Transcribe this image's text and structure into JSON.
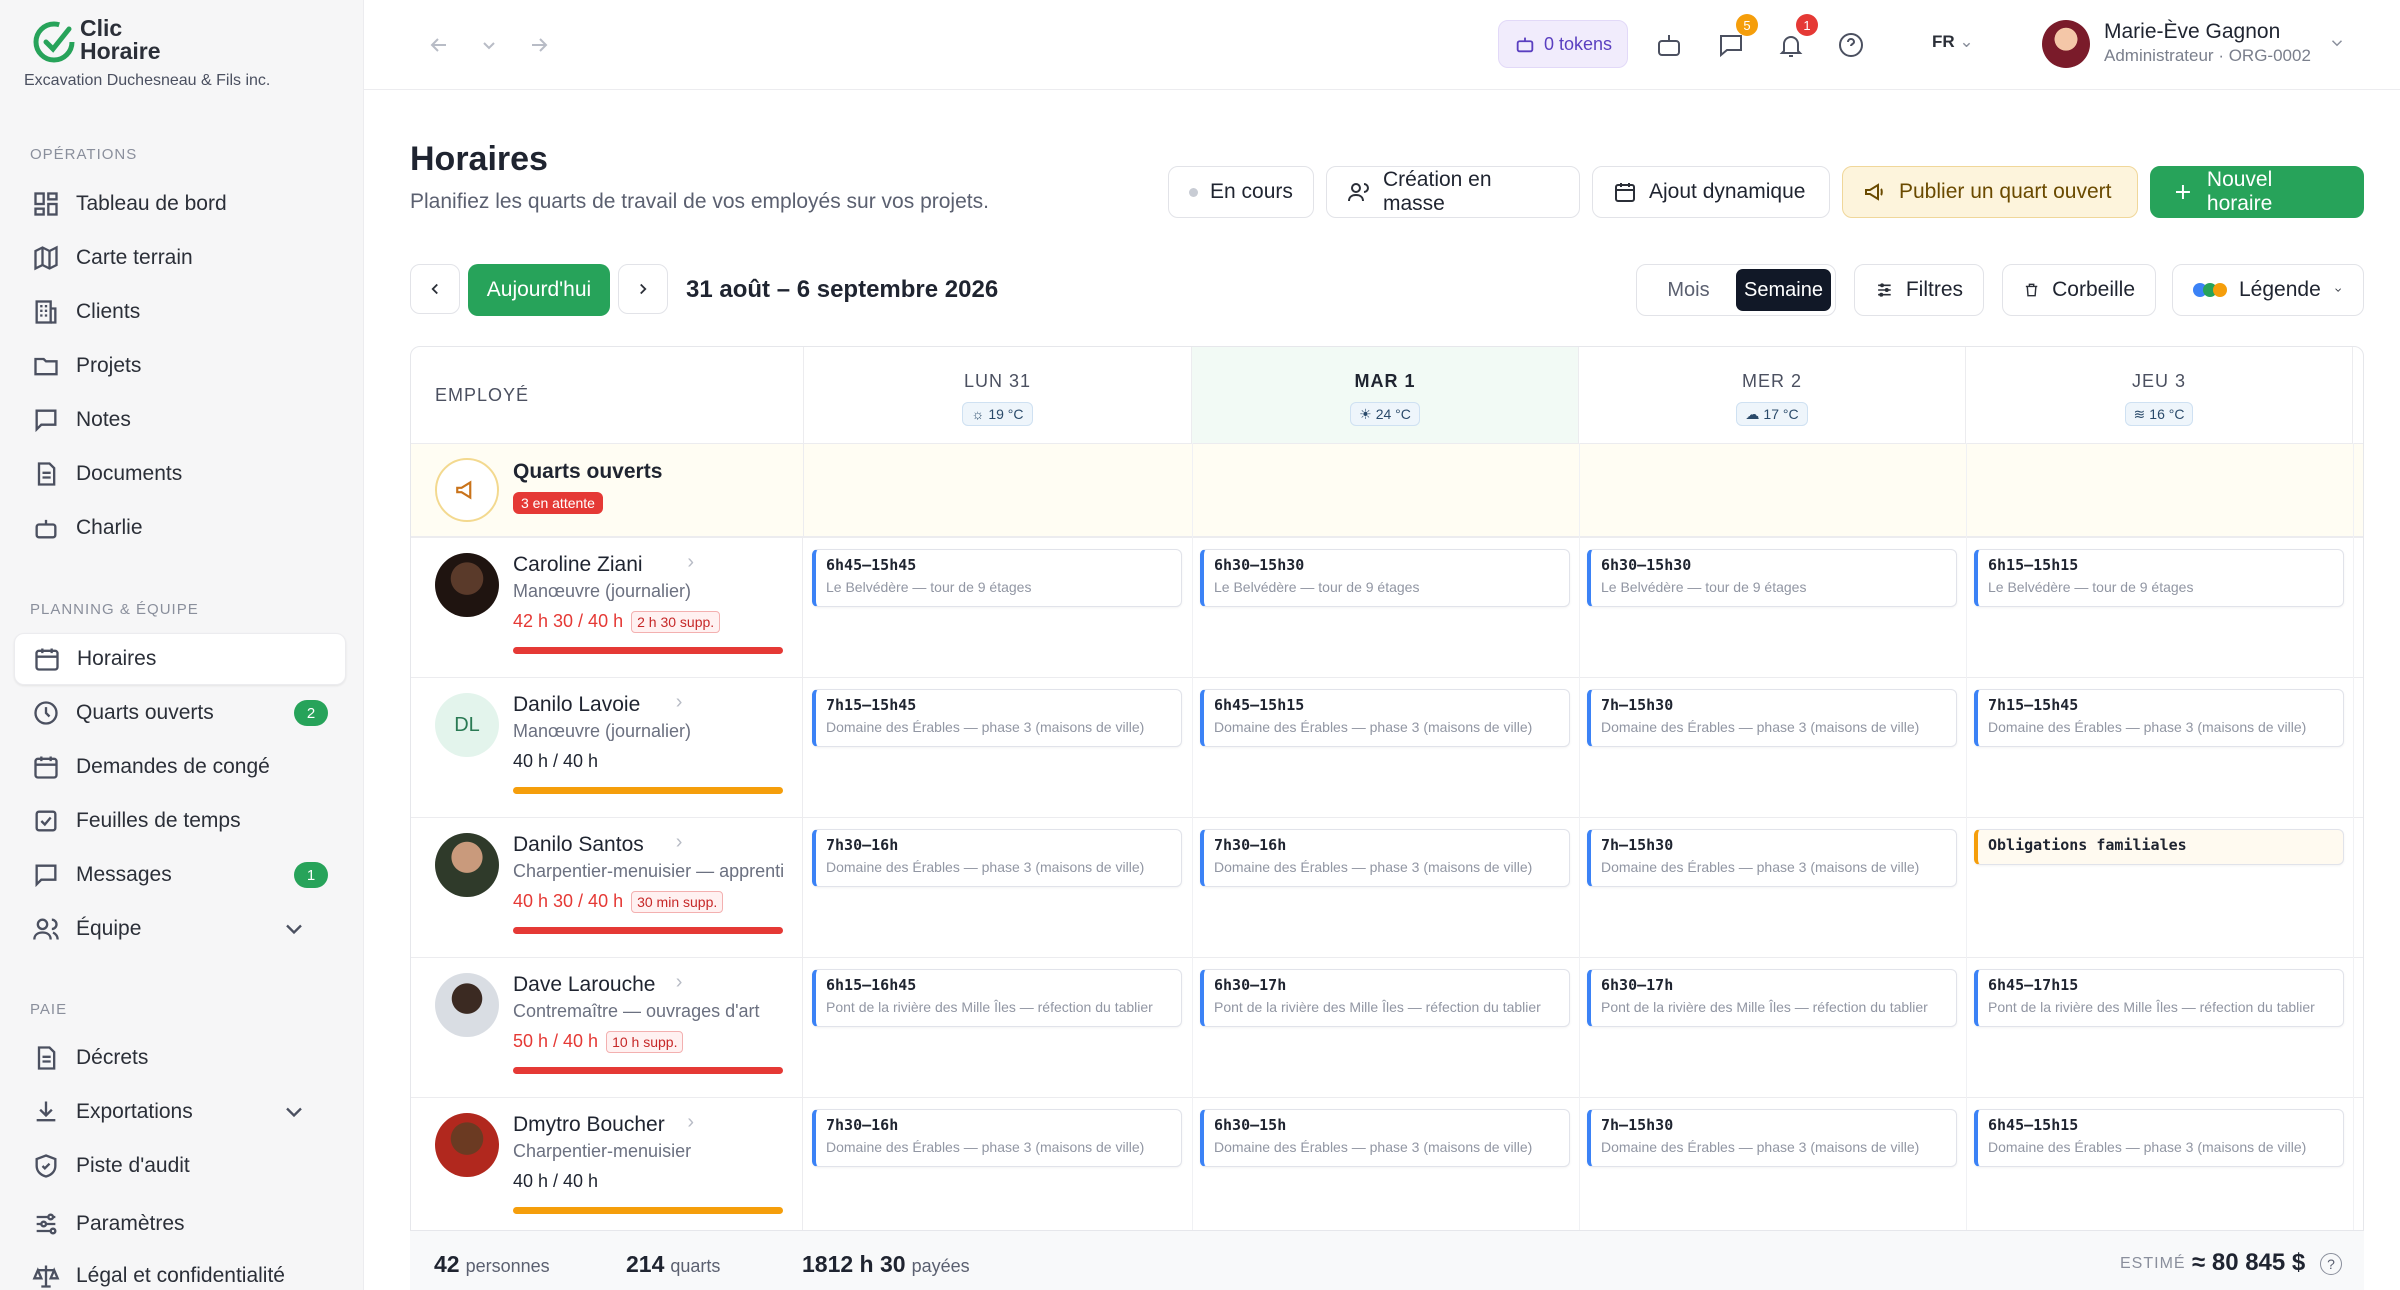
{
  "brand": {
    "name_line1": "Clic",
    "name_line2": "Horaire",
    "company": "Excavation Duchesneau & Fils inc."
  },
  "sidebar": {
    "sections": [
      {
        "label": "OPÉRATIONS"
      },
      {
        "label": "PLANNING & ÉQUIPE"
      },
      {
        "label": "PAIE"
      }
    ],
    "items": [
      {
        "label": "Tableau de bord",
        "icon": "dashboard-icon"
      },
      {
        "label": "Carte terrain",
        "icon": "map-icon"
      },
      {
        "label": "Clients",
        "icon": "building-icon"
      },
      {
        "label": "Projets",
        "icon": "folder-icon"
      },
      {
        "label": "Notes",
        "icon": "note-icon"
      },
      {
        "label": "Documents",
        "icon": "document-icon"
      },
      {
        "label": "Charlie",
        "icon": "robot-icon"
      },
      {
        "label": "Horaires",
        "icon": "calendar-icon"
      },
      {
        "label": "Quarts ouverts",
        "icon": "clock-icon",
        "badge": "2"
      },
      {
        "label": "Demandes de congé",
        "icon": "calendar-icon"
      },
      {
        "label": "Feuilles de temps",
        "icon": "checklist-icon"
      },
      {
        "label": "Messages",
        "icon": "message-icon",
        "badge": "1"
      },
      {
        "label": "Équipe",
        "icon": "users-icon"
      },
      {
        "label": "Décrets",
        "icon": "document-icon"
      },
      {
        "label": "Exportations",
        "icon": "download-icon"
      },
      {
        "label": "Piste d'audit",
        "icon": "shield-icon"
      },
      {
        "label": "Paramètres",
        "icon": "sliders-icon"
      },
      {
        "label": "Légal et confidentialité",
        "icon": "scale-icon"
      }
    ]
  },
  "topbar": {
    "tokens": "0 tokens",
    "messages_badge": "5",
    "notif_badge": "1",
    "lang": "FR",
    "user_name": "Marie-Ève Gagnon",
    "user_role": "Administrateur · ORG-0002"
  },
  "page": {
    "title": "Horaires",
    "subtitle": "Planifiez les quarts de travail de vos employés sur vos projets.",
    "actions": {
      "en_cours": "En cours",
      "creation": "Création en masse",
      "ajout": "Ajout dynamique",
      "publier": "Publier un quart ouvert",
      "nouvel": "Nouvel horaire"
    },
    "today": "Aujourd'hui",
    "range": "31 août – 6 septembre 2026",
    "views": {
      "mois": "Mois",
      "semaine": "Semaine"
    },
    "filters": "Filtres",
    "trash": "Corbeille",
    "legend": "Légende"
  },
  "grid": {
    "employee_header": "EMPLOYÉ",
    "days": [
      {
        "label": "LUN 31",
        "weather": "19 °C"
      },
      {
        "label": "MAR 1",
        "weather": "24 °C"
      },
      {
        "label": "MER 2",
        "weather": "17 °C"
      },
      {
        "label": "JEU 3",
        "weather": "16 °C"
      }
    ],
    "open_shifts": {
      "title": "Quarts ouverts",
      "badge": "3 en attente"
    },
    "employees": [
      {
        "name": "Caroline Ziani",
        "role": "Manœuvre (journalier)",
        "hours": "42 h 30 / 40 h",
        "supp": "2 h 30 supp.",
        "over": true,
        "shifts": [
          {
            "t": "6h45–15h45",
            "p": "Le Belvédère — tour de 9 étages"
          },
          {
            "t": "6h30–15h30",
            "p": "Le Belvédère — tour de 9 étages"
          },
          {
            "t": "6h30–15h30",
            "p": "Le Belvédère — tour de 9 étages"
          },
          {
            "t": "6h15–15h15",
            "p": "Le Belvédère — tour de 9 étages"
          }
        ]
      },
      {
        "name": "Danilo Lavoie",
        "initials": "DL",
        "role": "Manœuvre (journalier)",
        "hours": "40 h / 40 h",
        "supp": "",
        "over": false,
        "shifts": [
          {
            "t": "7h15–15h45",
            "p": "Domaine des Érables — phase 3 (maisons de ville)"
          },
          {
            "t": "6h45–15h15",
            "p": "Domaine des Érables — phase 3 (maisons de ville)"
          },
          {
            "t": "7h–15h30",
            "p": "Domaine des Érables — phase 3 (maisons de ville)"
          },
          {
            "t": "7h15–15h45",
            "p": "Domaine des Érables — phase 3 (maisons de ville)"
          }
        ]
      },
      {
        "name": "Danilo Santos",
        "role": "Charpentier-menuisier — apprenti",
        "hours": "40 h 30 / 40 h",
        "supp": "30 min supp.",
        "over": true,
        "shifts": [
          {
            "t": "7h30–16h",
            "p": "Domaine des Érables — phase 3 (maisons de ville)"
          },
          {
            "t": "7h30–16h",
            "p": "Domaine des Érables — phase 3 (maisons de ville)"
          },
          {
            "t": "7h–15h30",
            "p": "Domaine des Érables — phase 3 (maisons de ville)"
          },
          {
            "t": "Obligations familiales",
            "p": ""
          }
        ]
      },
      {
        "name": "Dave Larouche",
        "role": "Contremaître — ouvrages d'art",
        "hours": "50 h / 40 h",
        "supp": "10 h supp.",
        "over": true,
        "shifts": [
          {
            "t": "6h15–16h45",
            "p": "Pont de la rivière des Mille Îles — réfection du tablier"
          },
          {
            "t": "6h30–17h",
            "p": "Pont de la rivière des Mille Îles — réfection du tablier"
          },
          {
            "t": "6h30–17h",
            "p": "Pont de la rivière des Mille Îles — réfection du tablier"
          },
          {
            "t": "6h45–17h15",
            "p": "Pont de la rivière des Mille Îles — réfection du tablier"
          }
        ]
      },
      {
        "name": "Dmytro Boucher",
        "role": "Charpentier-menuisier",
        "hours": "40 h / 40 h",
        "supp": "",
        "over": false,
        "shifts": [
          {
            "t": "7h30–16h",
            "p": "Domaine des Érables — phase 3 (maisons de ville)"
          },
          {
            "t": "6h30–15h",
            "p": "Domaine des Érables — phase 3 (maisons de ville)"
          },
          {
            "t": "7h–15h30",
            "p": "Domaine des Érables — phase 3 (maisons de ville)"
          },
          {
            "t": "6h45–15h15",
            "p": "Domaine des Érables — phase 3 (maisons de ville)"
          }
        ]
      }
    ]
  },
  "footer": {
    "persons_n": "42",
    "persons_l": "personnes",
    "shifts_n": "214",
    "shifts_l": "quarts",
    "paid_n": "1812 h 30",
    "paid_l": "payées",
    "est_l": "ESTIMÉ",
    "est_v": "≈ 80 845 $"
  },
  "colors": {
    "accent": "#27a35a",
    "over": "#e53935",
    "ok": "#f59e0b",
    "shift_border": "#3b82f6"
  }
}
